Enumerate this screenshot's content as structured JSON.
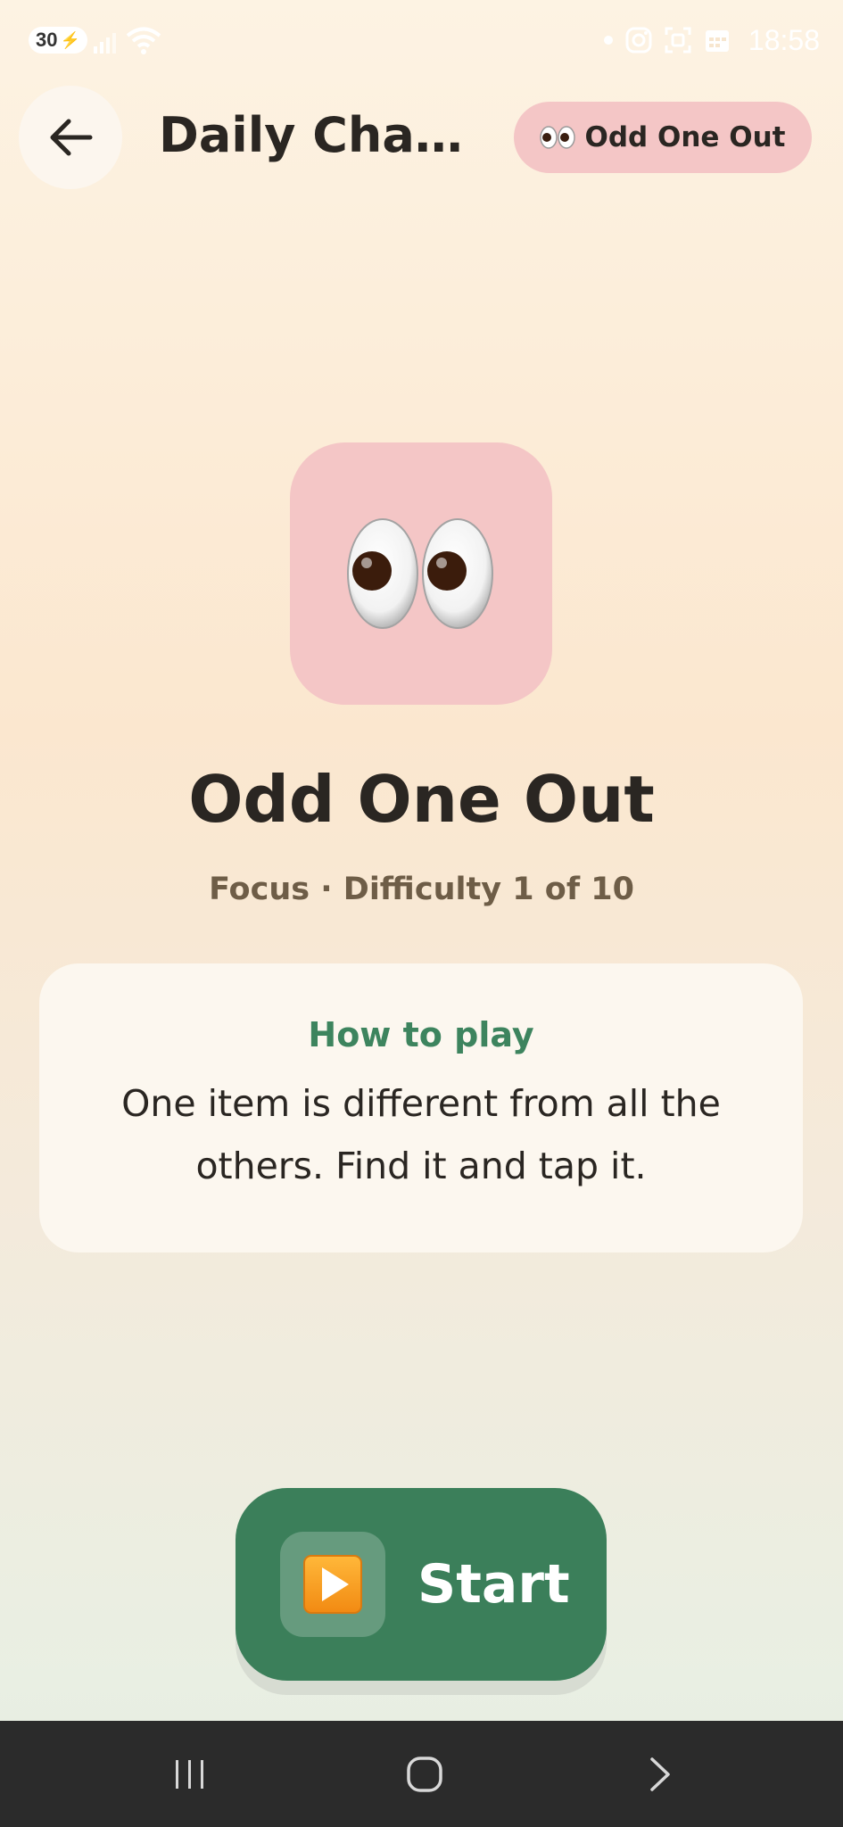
{
  "status_bar": {
    "battery": "30",
    "time": "18:58"
  },
  "header": {
    "title": "Daily Chal...",
    "chip_label": "Odd One Out",
    "chip_icon": "eyes-emoji-icon"
  },
  "game": {
    "icon": "eyes-emoji-icon",
    "title": "Odd One Out",
    "subtitle": "Focus · Difficulty 1 of 10",
    "category": "Focus",
    "difficulty": 1,
    "difficulty_max": 10
  },
  "how_to_play": {
    "title": "How to play",
    "body": "One item is different from all the others. Find it and tap it."
  },
  "start_button": {
    "label": "Start",
    "icon": "play-button-icon"
  },
  "colors": {
    "accent_green": "#3b7f5a",
    "chip_pink": "#f4c6c6",
    "how_title_green": "#3d845e"
  },
  "nav_bar": {
    "recents_icon": "recents-icon",
    "home_icon": "home-icon",
    "back_icon": "nav-back-icon"
  }
}
